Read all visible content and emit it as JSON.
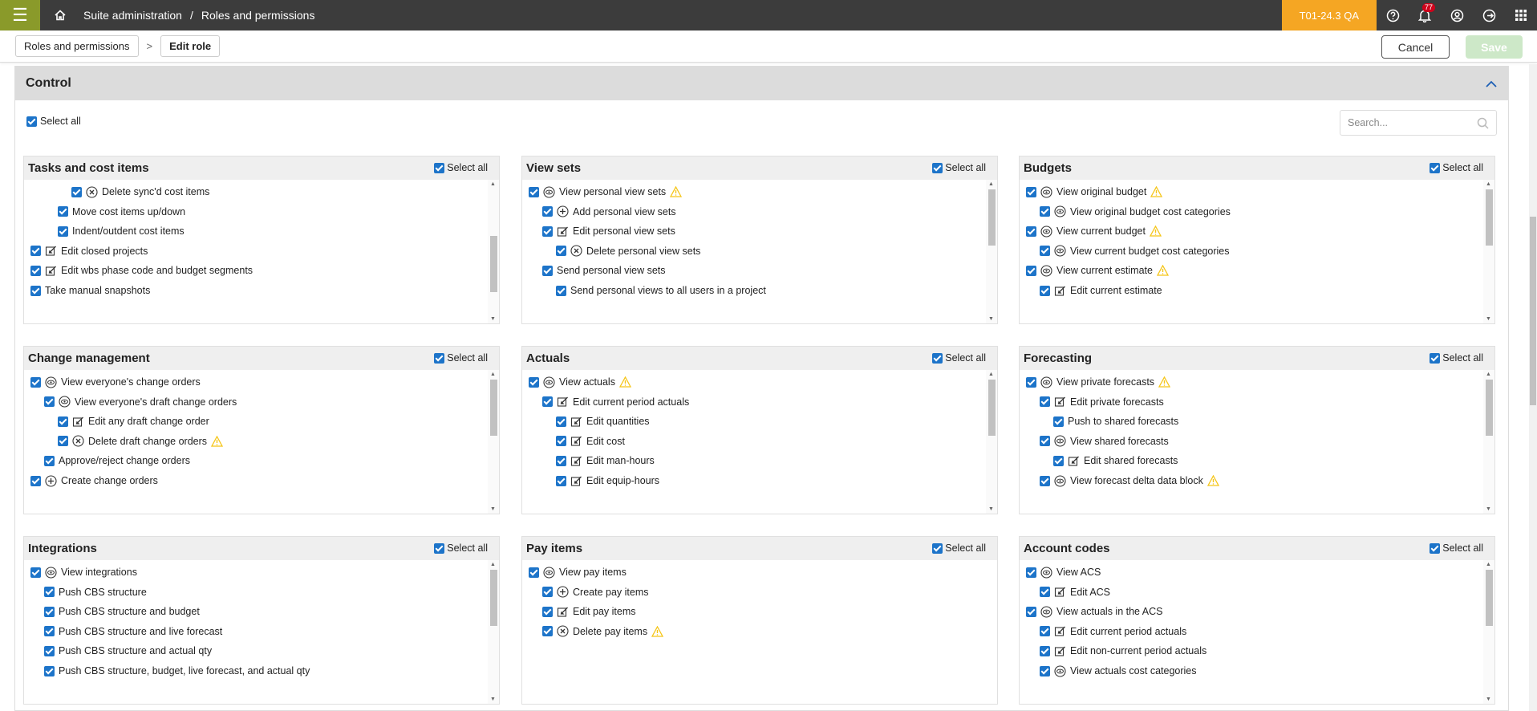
{
  "topbar": {
    "menu_icon": "hamburger-icon",
    "breadcrumb": [
      "Suite administration",
      "/",
      "Roles and permissions"
    ],
    "environment": "T01-24.3 QA",
    "notification_count": "77",
    "icons": [
      "help-icon",
      "bell-icon",
      "user-icon",
      "logout-icon",
      "apps-icon"
    ]
  },
  "subbar": {
    "crumb1": "Roles and permissions",
    "separator": ">",
    "crumb2": "Edit role",
    "cancel": "Cancel",
    "save": "Save"
  },
  "panel": {
    "title": "Control",
    "select_all": "Select all",
    "search_placeholder": "Search..."
  },
  "colors": {
    "accent": "#1d74c9",
    "env_badge": "#f5a623",
    "menu": "#8a9a2a",
    "warning": "#f5c518"
  },
  "cards": [
    {
      "title": "Tasks and cost items",
      "select_all": "Select all",
      "scroll_fraction": 0.7,
      "items": [
        {
          "indent": 3,
          "icon": "delete",
          "label": "Delete sync'd cost items",
          "warn": false
        },
        {
          "indent": 2,
          "icon": "",
          "label": "Move cost items up/down",
          "warn": false
        },
        {
          "indent": 2,
          "icon": "",
          "label": "Indent/outdent cost items",
          "warn": false
        },
        {
          "indent": 0,
          "icon": "edit",
          "label": "Edit closed projects",
          "warn": false
        },
        {
          "indent": 0,
          "icon": "edit",
          "label": "Edit wbs phase code and budget segments",
          "warn": false
        },
        {
          "indent": 0,
          "icon": "",
          "label": "Take manual snapshots",
          "warn": false
        }
      ]
    },
    {
      "title": "View sets",
      "select_all": "Select all",
      "scroll_fraction": 0,
      "items": [
        {
          "indent": 0,
          "icon": "view",
          "label": "View personal view sets",
          "warn": true
        },
        {
          "indent": 1,
          "icon": "add",
          "label": "Add personal view sets",
          "warn": false
        },
        {
          "indent": 1,
          "icon": "edit",
          "label": "Edit personal view sets",
          "warn": false
        },
        {
          "indent": 2,
          "icon": "delete",
          "label": "Delete personal view sets",
          "warn": false
        },
        {
          "indent": 1,
          "icon": "",
          "label": "Send personal view sets",
          "warn": false
        },
        {
          "indent": 2,
          "icon": "",
          "label": "Send personal views to all users in a project",
          "warn": false
        }
      ]
    },
    {
      "title": "Budgets",
      "select_all": "Select all",
      "scroll_fraction": 0,
      "items": [
        {
          "indent": 0,
          "icon": "view",
          "label": "View original budget",
          "warn": true
        },
        {
          "indent": 1,
          "icon": "view",
          "label": "View original budget cost categories",
          "warn": false
        },
        {
          "indent": 0,
          "icon": "view",
          "label": "View current budget",
          "warn": true
        },
        {
          "indent": 1,
          "icon": "view",
          "label": "View current budget cost categories",
          "warn": false
        },
        {
          "indent": 0,
          "icon": "view",
          "label": "View current estimate",
          "warn": true
        },
        {
          "indent": 1,
          "icon": "edit",
          "label": "Edit current estimate",
          "warn": false
        }
      ]
    },
    {
      "title": "Change management",
      "select_all": "Select all",
      "scroll_fraction": 0,
      "items": [
        {
          "indent": 0,
          "icon": "view",
          "label": "View everyone's change orders",
          "warn": false
        },
        {
          "indent": 1,
          "icon": "view",
          "label": "View everyone's draft change orders",
          "warn": false
        },
        {
          "indent": 2,
          "icon": "edit",
          "label": "Edit any draft change order",
          "warn": false
        },
        {
          "indent": 2,
          "icon": "delete",
          "label": "Delete draft change orders",
          "warn": true
        },
        {
          "indent": 1,
          "icon": "",
          "label": "Approve/reject change orders",
          "warn": false
        },
        {
          "indent": 0,
          "icon": "add",
          "label": "Create change orders",
          "warn": false
        }
      ]
    },
    {
      "title": "Actuals",
      "select_all": "Select all",
      "scroll_fraction": 0,
      "items": [
        {
          "indent": 0,
          "icon": "view",
          "label": "View actuals",
          "warn": true
        },
        {
          "indent": 1,
          "icon": "edit",
          "label": "Edit current period actuals",
          "warn": false
        },
        {
          "indent": 2,
          "icon": "edit",
          "label": "Edit quantities",
          "warn": false
        },
        {
          "indent": 2,
          "icon": "edit",
          "label": "Edit cost",
          "warn": false
        },
        {
          "indent": 2,
          "icon": "edit",
          "label": "Edit man-hours",
          "warn": false
        },
        {
          "indent": 2,
          "icon": "edit",
          "label": "Edit equip-hours",
          "warn": false
        }
      ]
    },
    {
      "title": "Forecasting",
      "select_all": "Select all",
      "scroll_fraction": 0,
      "items": [
        {
          "indent": 0,
          "icon": "view",
          "label": "View private forecasts",
          "warn": true
        },
        {
          "indent": 1,
          "icon": "edit",
          "label": "Edit private forecasts",
          "warn": false
        },
        {
          "indent": 2,
          "icon": "",
          "label": "Push to shared forecasts",
          "warn": false
        },
        {
          "indent": 1,
          "icon": "view",
          "label": "View shared forecasts",
          "warn": false
        },
        {
          "indent": 2,
          "icon": "edit",
          "label": "Edit shared forecasts",
          "warn": false
        },
        {
          "indent": 1,
          "icon": "view",
          "label": "View forecast delta data block",
          "warn": true
        }
      ]
    },
    {
      "title": "Integrations",
      "select_all": "Select all",
      "scroll_fraction": 0,
      "items": [
        {
          "indent": 0,
          "icon": "view",
          "label": "View integrations",
          "warn": false
        },
        {
          "indent": 1,
          "icon": "",
          "label": "Push CBS structure",
          "warn": false
        },
        {
          "indent": 1,
          "icon": "",
          "label": "Push CBS structure and budget",
          "warn": false
        },
        {
          "indent": 1,
          "icon": "",
          "label": "Push CBS structure and live forecast",
          "warn": false
        },
        {
          "indent": 1,
          "icon": "",
          "label": "Push CBS structure and actual qty",
          "warn": false
        },
        {
          "indent": 1,
          "icon": "",
          "label": "Push CBS structure, budget, live forecast, and actual qty",
          "warn": false
        }
      ]
    },
    {
      "title": "Pay items",
      "select_all": "Select all",
      "scroll_fraction": null,
      "items": [
        {
          "indent": 0,
          "icon": "view",
          "label": "View pay items",
          "warn": false
        },
        {
          "indent": 1,
          "icon": "add",
          "label": "Create pay items",
          "warn": false
        },
        {
          "indent": 1,
          "icon": "edit",
          "label": "Edit pay items",
          "warn": false
        },
        {
          "indent": 1,
          "icon": "delete",
          "label": "Delete pay items",
          "warn": true
        }
      ]
    },
    {
      "title": "Account codes",
      "select_all": "Select all",
      "scroll_fraction": 0,
      "items": [
        {
          "indent": 0,
          "icon": "view",
          "label": "View ACS",
          "warn": false
        },
        {
          "indent": 1,
          "icon": "edit",
          "label": "Edit ACS",
          "warn": false
        },
        {
          "indent": 0,
          "icon": "view",
          "label": "View actuals in the ACS",
          "warn": false
        },
        {
          "indent": 1,
          "icon": "edit",
          "label": "Edit current period actuals",
          "warn": false
        },
        {
          "indent": 1,
          "icon": "edit",
          "label": "Edit non-current period actuals",
          "warn": false
        },
        {
          "indent": 1,
          "icon": "view",
          "label": "View actuals cost categories",
          "warn": false
        }
      ]
    }
  ]
}
